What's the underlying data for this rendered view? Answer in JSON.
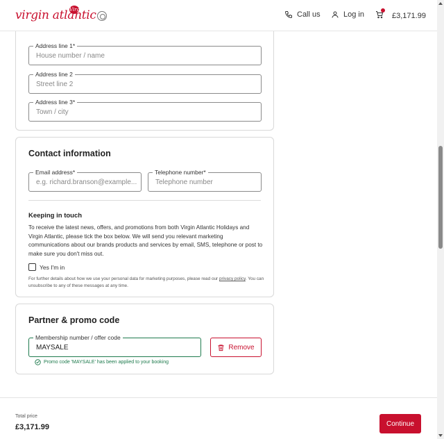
{
  "header": {
    "logo_text": "virgin atlantic",
    "logo_badge": "Virgin",
    "call_label": "Call us",
    "login_label": "Log in",
    "basket_total": "£3,171.99"
  },
  "address": {
    "line1": {
      "label": "Address line 1*",
      "placeholder": "House number / name"
    },
    "line2": {
      "label": "Address line 2",
      "placeholder": "Street line 2"
    },
    "line3": {
      "label": "Address line 3*",
      "placeholder": "Town / city"
    }
  },
  "contact": {
    "title": "Contact information",
    "email": {
      "label": "Email address*",
      "placeholder": "e.g. richard.branson@example...."
    },
    "phone": {
      "label": "Telephone number*",
      "placeholder": "Telephone number"
    },
    "keeping_title": "Keeping in touch",
    "keeping_text": "To receive the latest news, offers, and promotions from both Virgin Atlantic Holidays and Virgin Atlantic, please tick the box below. We will send you relevant marketing communications about our brands products and services by email, SMS, telephone or post to make sure you don't miss out.",
    "opt_in_label": "Yes I'm in",
    "fine_print_before": "For further details about how we use your personal data for marketing purposes, please read our ",
    "privacy_link": "privacy policy",
    "fine_print_after": ". You can unsubscribe to any of these messages at any time."
  },
  "promo": {
    "title": "Partner & promo code",
    "field_label": "Membership number / offer code",
    "field_value": "MAYSALE",
    "remove_label": "Remove",
    "applied_message": "Promo code 'MAYSALE' has been applied to your booking"
  },
  "footer": {
    "total_label": "Total price",
    "total_value": "£3,171.99",
    "continue_label": "Continue"
  },
  "colors": {
    "brand": "#c8102e",
    "success": "#1e7a4d"
  },
  "icons": [
    "phone-icon",
    "user-icon",
    "basket-icon",
    "trash-icon",
    "check-circle-icon"
  ]
}
